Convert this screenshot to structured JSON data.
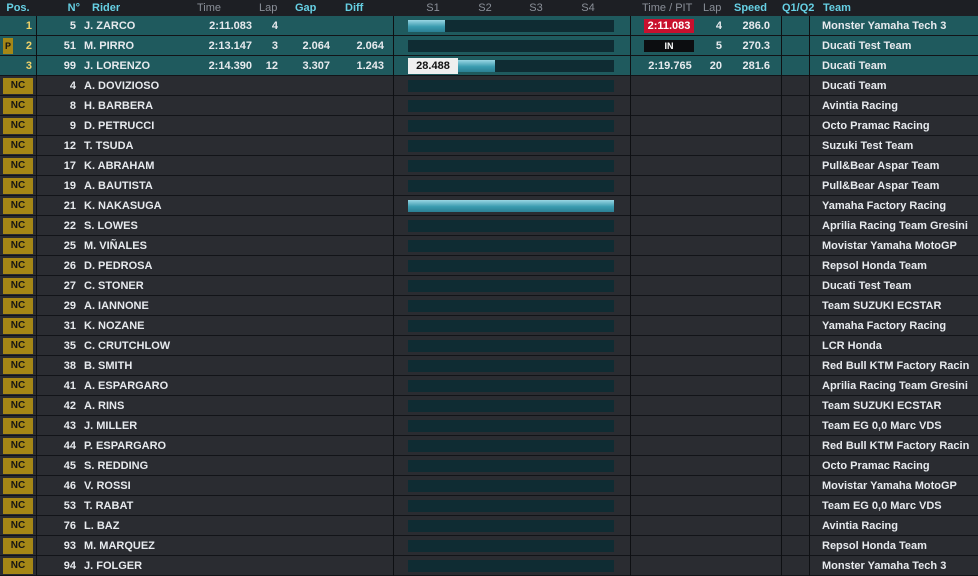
{
  "header": {
    "pos": "Pos.",
    "num": "N°",
    "rider": "Rider",
    "time": "Time",
    "lap": "Lap",
    "gap": "Gap",
    "diff": "Diff",
    "s1": "S1",
    "s2": "S2",
    "s3": "S3",
    "s4": "S4",
    "time_pit": "Time / PIT",
    "lap2": "Lap",
    "speed": "Speed",
    "q": "Q1/Q2",
    "team": "Team"
  },
  "colors": {
    "accent_header": "#66d0e4",
    "nc_badge": "#a58716",
    "top_row": "#1f5a5e",
    "row": "#2a2c31",
    "red_best": "#c8102e",
    "sector_bar": "#3b9cb0"
  },
  "rows": [
    {
      "pos": "1",
      "pit_badge": "",
      "nc": "",
      "num": "5",
      "rider": "J. ZARCO",
      "time": "2:11.083",
      "lap": "4",
      "gap": "",
      "diff": "",
      "sector_fill": 0.18,
      "split_time": "",
      "last": "2:11.083",
      "last_style": "red",
      "lap2": "4",
      "speed": "286.0",
      "q": "",
      "team": "Monster Yamaha Tech 3"
    },
    {
      "pos": "2",
      "pit_badge": "P",
      "nc": "",
      "num": "51",
      "rider": "M. PIRRO",
      "time": "2:13.147",
      "lap": "3",
      "gap": "2.064",
      "diff": "2.064",
      "sector_fill": 0,
      "split_time": "",
      "last": "IN",
      "last_style": "in",
      "lap2": "5",
      "speed": "270.3",
      "q": "",
      "team": "Ducati Test Team"
    },
    {
      "pos": "3",
      "pit_badge": "",
      "nc": "",
      "num": "99",
      "rider": "J. LORENZO",
      "time": "2:14.390",
      "lap": "12",
      "gap": "3.307",
      "diff": "1.243",
      "sector_fill": 0.42,
      "split_time": "28.488",
      "last": "2:19.765",
      "last_style": "",
      "lap2": "20",
      "speed": "281.6",
      "q": "",
      "team": "Ducati Team"
    },
    {
      "pos": "",
      "pit_badge": "",
      "nc": "NC",
      "num": "4",
      "rider": "A. DOVIZIOSO",
      "time": "",
      "lap": "",
      "gap": "",
      "diff": "",
      "sector_fill": 0,
      "split_time": "",
      "last": "",
      "last_style": "",
      "lap2": "",
      "speed": "",
      "q": "",
      "team": "Ducati Team"
    },
    {
      "pos": "",
      "pit_badge": "",
      "nc": "NC",
      "num": "8",
      "rider": "H. BARBERA",
      "time": "",
      "lap": "",
      "gap": "",
      "diff": "",
      "sector_fill": 0,
      "split_time": "",
      "last": "",
      "last_style": "",
      "lap2": "",
      "speed": "",
      "q": "",
      "team": "Avintia Racing"
    },
    {
      "pos": "",
      "pit_badge": "",
      "nc": "NC",
      "num": "9",
      "rider": "D. PETRUCCI",
      "time": "",
      "lap": "",
      "gap": "",
      "diff": "",
      "sector_fill": 0,
      "split_time": "",
      "last": "",
      "last_style": "",
      "lap2": "",
      "speed": "",
      "q": "",
      "team": "Octo Pramac Racing"
    },
    {
      "pos": "",
      "pit_badge": "",
      "nc": "NC",
      "num": "12",
      "rider": "T. TSUDA",
      "time": "",
      "lap": "",
      "gap": "",
      "diff": "",
      "sector_fill": 0,
      "split_time": "",
      "last": "",
      "last_style": "",
      "lap2": "",
      "speed": "",
      "q": "",
      "team": "Suzuki Test Team"
    },
    {
      "pos": "",
      "pit_badge": "",
      "nc": "NC",
      "num": "17",
      "rider": "K. ABRAHAM",
      "time": "",
      "lap": "",
      "gap": "",
      "diff": "",
      "sector_fill": 0,
      "split_time": "",
      "last": "",
      "last_style": "",
      "lap2": "",
      "speed": "",
      "q": "",
      "team": "Pull&Bear Aspar Team"
    },
    {
      "pos": "",
      "pit_badge": "",
      "nc": "NC",
      "num": "19",
      "rider": "A. BAUTISTA",
      "time": "",
      "lap": "",
      "gap": "",
      "diff": "",
      "sector_fill": 0,
      "split_time": "",
      "last": "",
      "last_style": "",
      "lap2": "",
      "speed": "",
      "q": "",
      "team": "Pull&Bear Aspar Team"
    },
    {
      "pos": "",
      "pit_badge": "",
      "nc": "NC",
      "num": "21",
      "rider": "K. NAKASUGA",
      "time": "",
      "lap": "",
      "gap": "",
      "diff": "",
      "sector_fill": 1.0,
      "split_time": "",
      "last": "",
      "last_style": "",
      "lap2": "",
      "speed": "",
      "q": "",
      "team": "Yamaha Factory Racing"
    },
    {
      "pos": "",
      "pit_badge": "",
      "nc": "NC",
      "num": "22",
      "rider": "S. LOWES",
      "time": "",
      "lap": "",
      "gap": "",
      "diff": "",
      "sector_fill": 0,
      "split_time": "",
      "last": "",
      "last_style": "",
      "lap2": "",
      "speed": "",
      "q": "",
      "team": "Aprilia Racing Team Gresini"
    },
    {
      "pos": "",
      "pit_badge": "",
      "nc": "NC",
      "num": "25",
      "rider": "M. VIÑALES",
      "time": "",
      "lap": "",
      "gap": "",
      "diff": "",
      "sector_fill": 0,
      "split_time": "",
      "last": "",
      "last_style": "",
      "lap2": "",
      "speed": "",
      "q": "",
      "team": "Movistar Yamaha MotoGP"
    },
    {
      "pos": "",
      "pit_badge": "",
      "nc": "NC",
      "num": "26",
      "rider": "D. PEDROSA",
      "time": "",
      "lap": "",
      "gap": "",
      "diff": "",
      "sector_fill": 0,
      "split_time": "",
      "last": "",
      "last_style": "",
      "lap2": "",
      "speed": "",
      "q": "",
      "team": "Repsol Honda Team"
    },
    {
      "pos": "",
      "pit_badge": "",
      "nc": "NC",
      "num": "27",
      "rider": "C. STONER",
      "time": "",
      "lap": "",
      "gap": "",
      "diff": "",
      "sector_fill": 0,
      "split_time": "",
      "last": "",
      "last_style": "",
      "lap2": "",
      "speed": "",
      "q": "",
      "team": "Ducati Test Team"
    },
    {
      "pos": "",
      "pit_badge": "",
      "nc": "NC",
      "num": "29",
      "rider": "A. IANNONE",
      "time": "",
      "lap": "",
      "gap": "",
      "diff": "",
      "sector_fill": 0,
      "split_time": "",
      "last": "",
      "last_style": "",
      "lap2": "",
      "speed": "",
      "q": "",
      "team": "Team SUZUKI ECSTAR"
    },
    {
      "pos": "",
      "pit_badge": "",
      "nc": "NC",
      "num": "31",
      "rider": "K. NOZANE",
      "time": "",
      "lap": "",
      "gap": "",
      "diff": "",
      "sector_fill": 0,
      "split_time": "",
      "last": "",
      "last_style": "",
      "lap2": "",
      "speed": "",
      "q": "",
      "team": "Yamaha Factory Racing"
    },
    {
      "pos": "",
      "pit_badge": "",
      "nc": "NC",
      "num": "35",
      "rider": "C. CRUTCHLOW",
      "time": "",
      "lap": "",
      "gap": "",
      "diff": "",
      "sector_fill": 0,
      "split_time": "",
      "last": "",
      "last_style": "",
      "lap2": "",
      "speed": "",
      "q": "",
      "team": "LCR Honda"
    },
    {
      "pos": "",
      "pit_badge": "",
      "nc": "NC",
      "num": "38",
      "rider": "B. SMITH",
      "time": "",
      "lap": "",
      "gap": "",
      "diff": "",
      "sector_fill": 0,
      "split_time": "",
      "last": "",
      "last_style": "",
      "lap2": "",
      "speed": "",
      "q": "",
      "team": "Red Bull KTM Factory Racin"
    },
    {
      "pos": "",
      "pit_badge": "",
      "nc": "NC",
      "num": "41",
      "rider": "A. ESPARGARO",
      "time": "",
      "lap": "",
      "gap": "",
      "diff": "",
      "sector_fill": 0,
      "split_time": "",
      "last": "",
      "last_style": "",
      "lap2": "",
      "speed": "",
      "q": "",
      "team": "Aprilia Racing Team Gresini"
    },
    {
      "pos": "",
      "pit_badge": "",
      "nc": "NC",
      "num": "42",
      "rider": "A. RINS",
      "time": "",
      "lap": "",
      "gap": "",
      "diff": "",
      "sector_fill": 0,
      "split_time": "",
      "last": "",
      "last_style": "",
      "lap2": "",
      "speed": "",
      "q": "",
      "team": "Team SUZUKI ECSTAR"
    },
    {
      "pos": "",
      "pit_badge": "",
      "nc": "NC",
      "num": "43",
      "rider": "J. MILLER",
      "time": "",
      "lap": "",
      "gap": "",
      "diff": "",
      "sector_fill": 0,
      "split_time": "",
      "last": "",
      "last_style": "",
      "lap2": "",
      "speed": "",
      "q": "",
      "team": "Team EG 0,0 Marc VDS"
    },
    {
      "pos": "",
      "pit_badge": "",
      "nc": "NC",
      "num": "44",
      "rider": "P. ESPARGARO",
      "time": "",
      "lap": "",
      "gap": "",
      "diff": "",
      "sector_fill": 0,
      "split_time": "",
      "last": "",
      "last_style": "",
      "lap2": "",
      "speed": "",
      "q": "",
      "team": "Red Bull KTM Factory Racin"
    },
    {
      "pos": "",
      "pit_badge": "",
      "nc": "NC",
      "num": "45",
      "rider": "S. REDDING",
      "time": "",
      "lap": "",
      "gap": "",
      "diff": "",
      "sector_fill": 0,
      "split_time": "",
      "last": "",
      "last_style": "",
      "lap2": "",
      "speed": "",
      "q": "",
      "team": "Octo Pramac Racing"
    },
    {
      "pos": "",
      "pit_badge": "",
      "nc": "NC",
      "num": "46",
      "rider": "V. ROSSI",
      "time": "",
      "lap": "",
      "gap": "",
      "diff": "",
      "sector_fill": 0,
      "split_time": "",
      "last": "",
      "last_style": "",
      "lap2": "",
      "speed": "",
      "q": "",
      "team": "Movistar Yamaha MotoGP"
    },
    {
      "pos": "",
      "pit_badge": "",
      "nc": "NC",
      "num": "53",
      "rider": "T. RABAT",
      "time": "",
      "lap": "",
      "gap": "",
      "diff": "",
      "sector_fill": 0,
      "split_time": "",
      "last": "",
      "last_style": "",
      "lap2": "",
      "speed": "",
      "q": "",
      "team": "Team EG 0,0 Marc VDS"
    },
    {
      "pos": "",
      "pit_badge": "",
      "nc": "NC",
      "num": "76",
      "rider": "L. BAZ",
      "time": "",
      "lap": "",
      "gap": "",
      "diff": "",
      "sector_fill": 0,
      "split_time": "",
      "last": "",
      "last_style": "",
      "lap2": "",
      "speed": "",
      "q": "",
      "team": "Avintia Racing"
    },
    {
      "pos": "",
      "pit_badge": "",
      "nc": "NC",
      "num": "93",
      "rider": "M. MARQUEZ",
      "time": "",
      "lap": "",
      "gap": "",
      "diff": "",
      "sector_fill": 0,
      "split_time": "",
      "last": "",
      "last_style": "",
      "lap2": "",
      "speed": "",
      "q": "",
      "team": "Repsol Honda Team"
    },
    {
      "pos": "",
      "pit_badge": "",
      "nc": "NC",
      "num": "94",
      "rider": "J. FOLGER",
      "time": "",
      "lap": "",
      "gap": "",
      "diff": "",
      "sector_fill": 0,
      "split_time": "",
      "last": "",
      "last_style": "",
      "lap2": "",
      "speed": "",
      "q": "",
      "team": "Monster Yamaha Tech 3"
    }
  ]
}
